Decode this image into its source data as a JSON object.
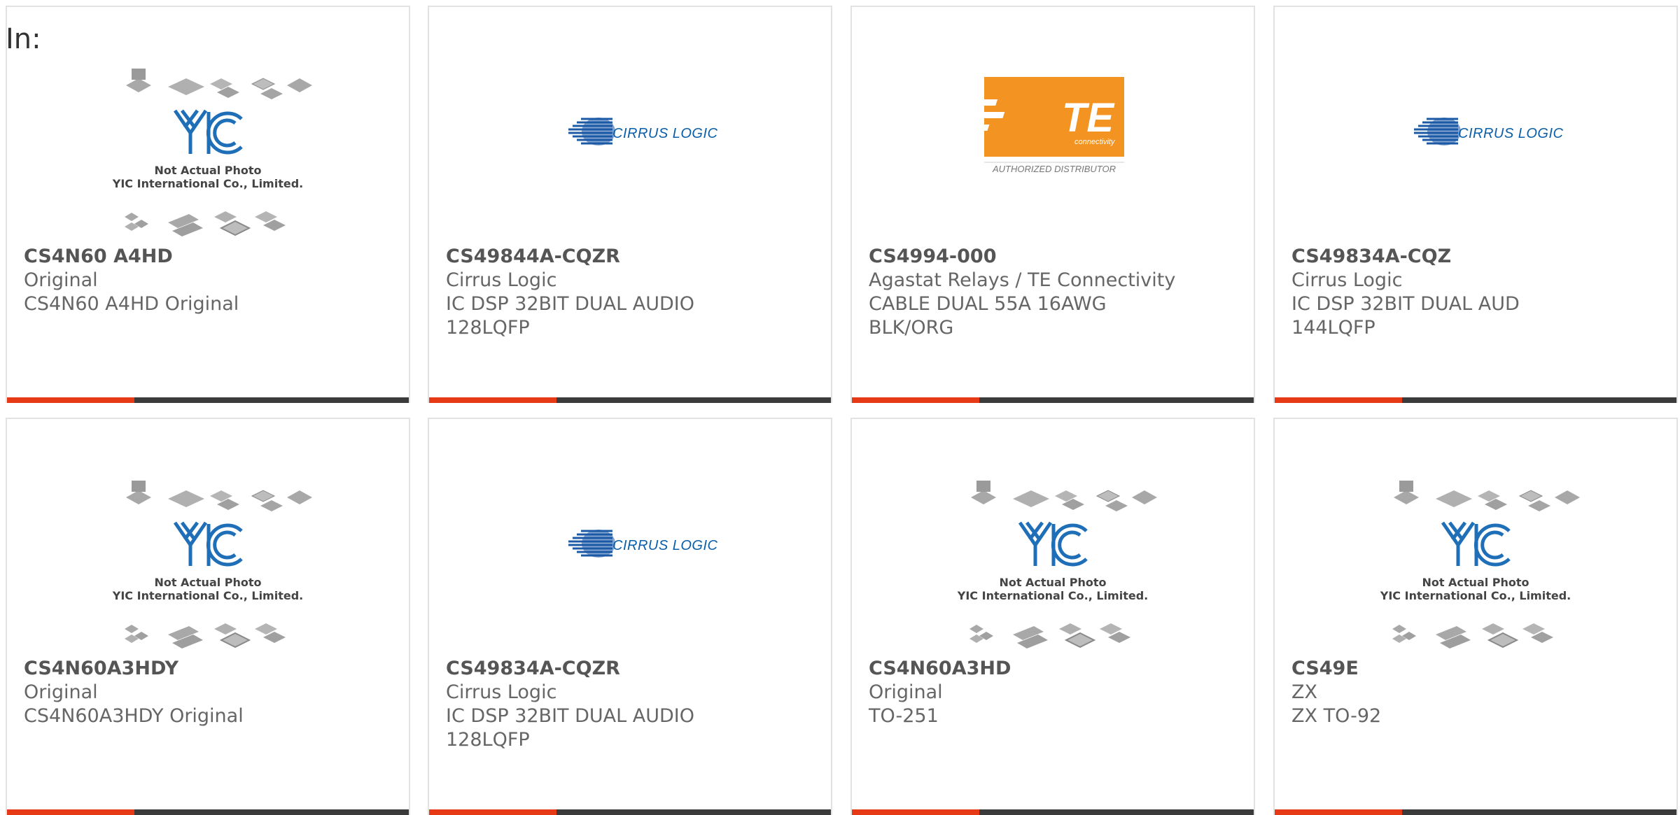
{
  "page_label": "In:",
  "colors": {
    "accent": "#e63a17",
    "bar_dark": "#3b3b3b",
    "card_border": "#e2e2e2",
    "cirrus_blue": "#0b5ea8",
    "te_orange": "#f39322"
  },
  "placeholder_logo": {
    "brand": "YIC",
    "line1": "Not Actual Photo",
    "line2": "YIC International Co., Limited."
  },
  "cirrus_logo": {
    "text": "CIRRUS LOGIC"
  },
  "te_logo": {
    "brand": "TE",
    "sub": "connectivity",
    "caption": "AUTHORIZED DISTRIBUTOR"
  },
  "products": [
    {
      "part": "CS4N60 A4HD",
      "maker": "Original",
      "desc": "CS4N60 A4HD Original",
      "image": "placeholder"
    },
    {
      "part": "CS49844A-CQZR",
      "maker": "Cirrus Logic",
      "desc": "IC DSP 32BIT DUAL AUDIO\n128LQFP",
      "image": "cirrus"
    },
    {
      "part": "CS4994-000",
      "maker": "Agastat Relays / TE Connectivity",
      "desc": "CABLE DUAL 55A 16AWG\nBLK/ORG",
      "image": "te"
    },
    {
      "part": "CS49834A-CQZ",
      "maker": "Cirrus Logic",
      "desc": "IC DSP 32BIT DUAL AUD\n144LQFP",
      "image": "cirrus"
    },
    {
      "part": "CS4N60A3HDY",
      "maker": "Original",
      "desc": "CS4N60A3HDY Original",
      "image": "placeholder"
    },
    {
      "part": "CS49834A-CQZR",
      "maker": "Cirrus Logic",
      "desc": "IC DSP 32BIT DUAL AUDIO\n128LQFP",
      "image": "cirrus"
    },
    {
      "part": "CS4N60A3HD",
      "maker": "Original",
      "desc": "TO-251",
      "image": "placeholder"
    },
    {
      "part": "CS49E",
      "maker": "ZX",
      "desc": "ZX TO-92",
      "image": "placeholder"
    }
  ]
}
